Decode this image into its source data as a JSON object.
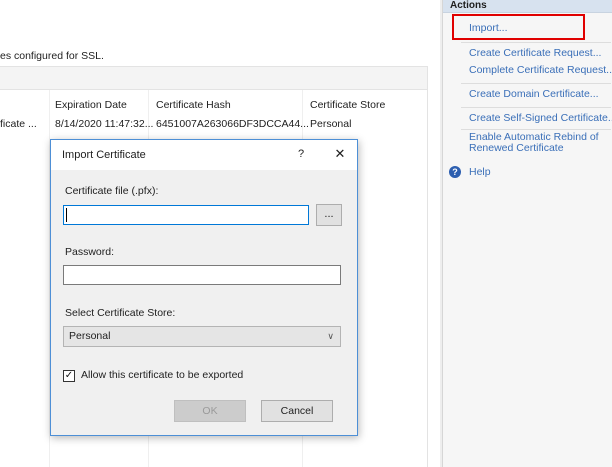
{
  "main": {
    "description": "es configured for SSL.",
    "columns": [
      "Expiration Date",
      "Certificate Hash",
      "Certificate Store"
    ],
    "row": {
      "name_fragment": "ficate ...",
      "expiration": "8/14/2020 11:47:32...",
      "hash": "6451007A263066DF3DCCA44...",
      "store": "Personal"
    }
  },
  "actions": {
    "title": "Actions",
    "items": [
      "Import...",
      "Create Certificate Request...",
      "Complete Certificate Request...",
      "Create Domain Certificate...",
      "Create Self-Signed Certificate...",
      "Enable Automatic Rebind of Renewed Certificate"
    ],
    "help": "Help",
    "highlight_color": "#e00000"
  },
  "dialog": {
    "title": "Import Certificate",
    "help_glyph": "?",
    "close_glyph": "✕",
    "cert_file_label": "Certificate file (.pfx):",
    "cert_file_value": "",
    "browse_label": "...",
    "password_label": "Password:",
    "password_value": "",
    "store_label": "Select Certificate Store:",
    "store_value": "Personal",
    "export_checked": true,
    "export_label": "Allow this certificate to be exported",
    "ok_label": "OK",
    "cancel_label": "Cancel"
  },
  "icons": {
    "help": "help-icon",
    "chevron": "chevron-down-icon",
    "checkbox": "checkmark-icon"
  }
}
